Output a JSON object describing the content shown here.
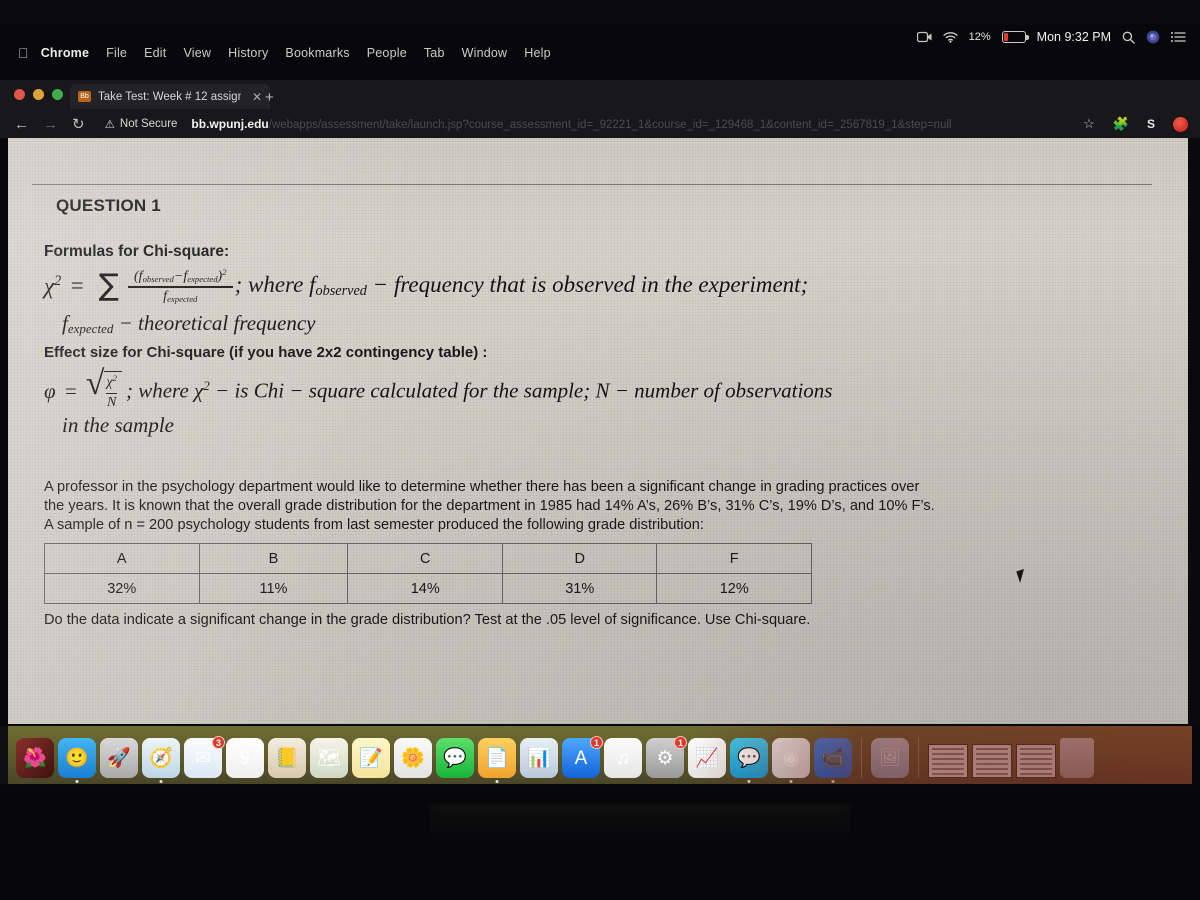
{
  "menubar": {
    "apple_icon": "apple-logo-icon",
    "items": [
      {
        "label": "Chrome",
        "bold": true
      },
      {
        "label": "File",
        "bold": false
      },
      {
        "label": "Edit",
        "bold": false
      },
      {
        "label": "View",
        "bold": false
      },
      {
        "label": "History",
        "bold": false
      },
      {
        "label": "Bookmarks",
        "bold": false
      },
      {
        "label": "People",
        "bold": false
      },
      {
        "label": "Tab",
        "bold": false
      },
      {
        "label": "Window",
        "bold": false
      },
      {
        "label": "Help",
        "bold": false
      }
    ]
  },
  "status": {
    "screen_recording_icon": "screen-record-icon",
    "wifi_icon": "wifi-icon",
    "battery_percent": "12%",
    "battery_color": "#e03b2f",
    "clock": "Mon 9:32 PM",
    "search_icon": "spotlight-search-icon",
    "siri_icon": "siri-icon",
    "control_center_icon": "control-center-icon"
  },
  "browser": {
    "tab": {
      "favicon": "blackboard-favicon",
      "favicon_text": "Bb",
      "title": "Take Test: Week # 12 assignm",
      "close_icon": "close-tab-icon"
    },
    "new_tab_icon": "new-tab-plus-icon",
    "back_icon": "back-arrow-icon",
    "forward_icon": "forward-arrow-icon",
    "reload_icon": "reload-icon",
    "security": {
      "warning_icon": "not-secure-warning-icon",
      "label": "Not Secure"
    },
    "url_host": "bb.wpunj.edu",
    "url_path": "/webapps/assessment/take/launch.jsp?course_assessment_id=_92221_1&course_id=_129468_1&content_id=_2567819_1&step=null",
    "bookmark_icon": "star-bookmark-icon",
    "extensions_icon": "puzzle-extensions-icon",
    "profile_initial": "S",
    "profile_avatar_icon": "profile-avatar-icon"
  },
  "question": {
    "heading": "QUESTION 1",
    "formulas_label": "Formulas for Chi-square:",
    "chi_formula": {
      "lhs": "χ",
      "lhs_sup": "2",
      "equals": "=",
      "sum": "∑",
      "numerator_open": "(f",
      "numerator_sub1": "observed",
      "numerator_minus": "−f",
      "numerator_sub2": "expected",
      "numerator_close": ")",
      "numerator_sup": "2",
      "denominator": "f",
      "denominator_sub": "expected",
      "tail": "; where f",
      "tail_sub": "observed",
      "tail_rest": "−  frequency that is observed in the experiment;"
    },
    "fexpected_line": {
      "symbol": "f",
      "symbol_sub": "expected",
      "text": "−  theoretical frequency"
    },
    "effect_size_label": "Effect size for Chi-square (if you have 2x2 contingency table) :",
    "phi_formula": {
      "phi": "φ",
      "equals": "=",
      "radical": "√",
      "num": "χ",
      "num_sup": "2",
      "den": "N",
      "tail": "; where χ",
      "tail_sup": "2",
      "tail_rest": "−  is Chi − square calculated for the sample;  N −  number of observations",
      "line2": "in the sample"
    },
    "prompt_line1": "A professor in the psychology department would like to determine whether there has been a significant change in grading practices over",
    "prompt_line2": "the years. It is known that the overall grade distribution for the department in 1985 had 14% A’s, 26% B’s, 31% C’s, 19% D’s, and 10% F’s.",
    "prompt_line3": "A sample of n = 200 psychology students from last semester produced the following grade distribution:",
    "table": {
      "headers": [
        "A",
        "B",
        "C",
        "D",
        "F"
      ],
      "values": [
        "32%",
        "11%",
        "14%",
        "31%",
        "12%"
      ]
    },
    "closing": "Do the data indicate a significant change in the grade distribution? Test at the .05 level of significance. Use Chi-square."
  },
  "dock": {
    "items": [
      {
        "name": "photos-wallpaper-app",
        "glyph": "🌺",
        "bg": "linear-gradient(135deg,#8c2f2a,#3b1210)",
        "dot": false,
        "badge": ""
      },
      {
        "name": "finder",
        "glyph": "🙂",
        "bg": "linear-gradient(180deg,#42b6f5,#1a7fd0)",
        "dot": true,
        "badge": ""
      },
      {
        "name": "launchpad",
        "glyph": "🚀",
        "bg": "linear-gradient(180deg,#d9d9d9,#a9a9a9)",
        "dot": false,
        "badge": ""
      },
      {
        "name": "safari",
        "glyph": "🧭",
        "bg": "linear-gradient(180deg,#eef4f8,#bcd6e8)",
        "dot": true,
        "badge": ""
      },
      {
        "name": "mail",
        "glyph": "✉",
        "bg": "linear-gradient(180deg,#fdfdfd,#dbe7f3)",
        "dot": false,
        "badge": "3"
      },
      {
        "name": "calendar",
        "glyph": "9",
        "bg": "linear-gradient(180deg,#ffffff,#efefef)",
        "dot": false,
        "badge": ""
      },
      {
        "name": "contacts",
        "glyph": "📒",
        "bg": "linear-gradient(180deg,#f3ece0,#d8c9ae)",
        "dot": false,
        "badge": ""
      },
      {
        "name": "maps",
        "glyph": "🗺",
        "bg": "linear-gradient(180deg,#f6f3e9,#cfd9c4)",
        "dot": false,
        "badge": ""
      },
      {
        "name": "notes",
        "glyph": "📝",
        "bg": "linear-gradient(180deg,#fff7c8,#f4e49a)",
        "dot": false,
        "badge": ""
      },
      {
        "name": "photos",
        "glyph": "🌼",
        "bg": "linear-gradient(180deg,#fafafa,#e2e2e2)",
        "dot": false,
        "badge": ""
      },
      {
        "name": "messages",
        "glyph": "💬",
        "bg": "linear-gradient(180deg,#5de06a,#19b43a)",
        "dot": false,
        "badge": ""
      },
      {
        "name": "pages",
        "glyph": "📄",
        "bg": "linear-gradient(180deg,#ffd05e,#f0a32c)",
        "dot": true,
        "badge": ""
      },
      {
        "name": "keynote",
        "glyph": "📊",
        "bg": "linear-gradient(180deg,#e8eef5,#b9c9da)",
        "dot": false,
        "badge": ""
      },
      {
        "name": "app-store",
        "glyph": "A",
        "bg": "linear-gradient(180deg,#4ea7ff,#1464d8)",
        "dot": false,
        "badge": "1"
      },
      {
        "name": "itunes-music",
        "glyph": "♫",
        "bg": "linear-gradient(180deg,#fcfcfc,#e6e6e6)",
        "dot": false,
        "badge": ""
      },
      {
        "name": "system-preferences",
        "glyph": "⚙",
        "bg": "linear-gradient(180deg,#cfcfcf,#9a9a9a)",
        "dot": false,
        "badge": "1"
      },
      {
        "name": "numbers",
        "glyph": "📈",
        "bg": "linear-gradient(180deg,#fbfbfb,#e4e4e4)",
        "dot": false,
        "badge": ""
      },
      {
        "name": "whatsapp-messenger",
        "glyph": "💬",
        "bg": "linear-gradient(180deg,#3fd0f5,#13a0da)",
        "dot": true,
        "badge": ""
      },
      {
        "name": "google-chrome",
        "glyph": "◉",
        "bg": "linear-gradient(180deg,#fafafa,#dadada)",
        "dot": true,
        "badge": ""
      },
      {
        "name": "zoom",
        "glyph": "📹",
        "bg": "linear-gradient(180deg,#3a8bf5,#1468d8)",
        "dot": true,
        "badge": ""
      }
    ],
    "recent_items": [
      {
        "name": "preview-document",
        "glyph": "🖼"
      }
    ],
    "minimized_windows": [
      {
        "name": "minimized-window-1"
      },
      {
        "name": "minimized-window-2"
      },
      {
        "name": "minimized-window-3"
      }
    ],
    "trash": {
      "name": "trash-icon"
    }
  }
}
